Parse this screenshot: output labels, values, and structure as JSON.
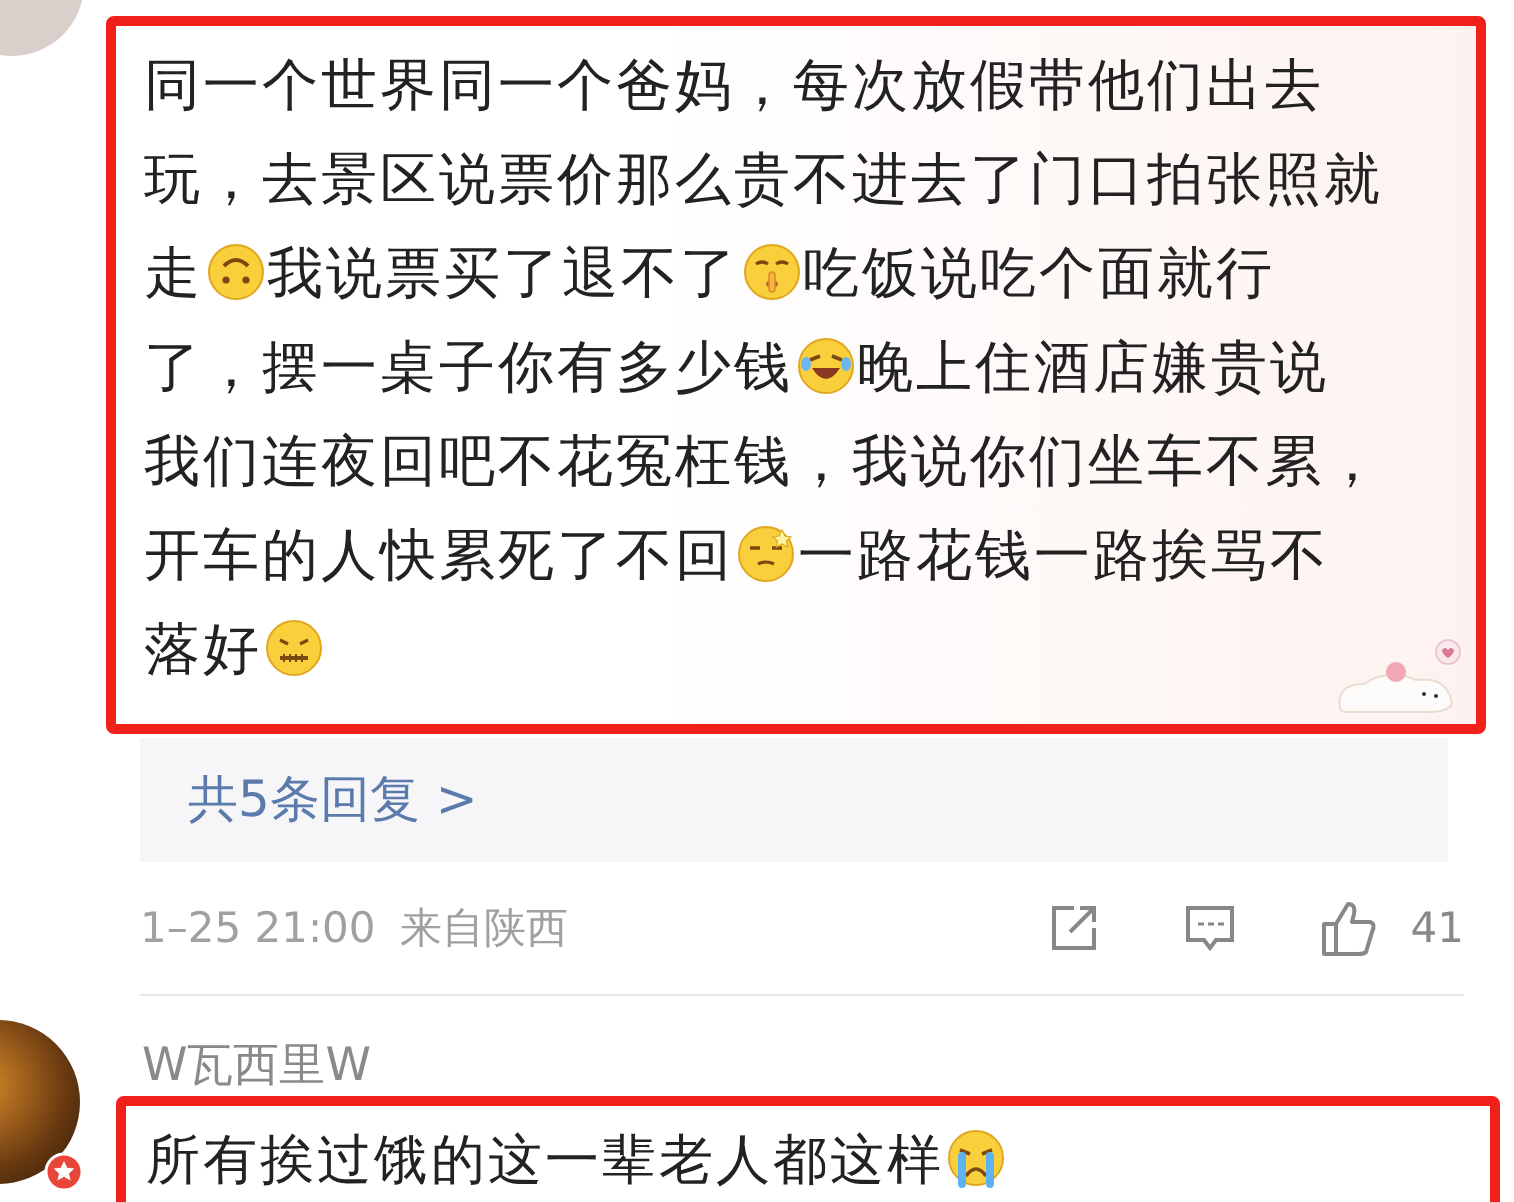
{
  "comments": [
    {
      "highlighted": true,
      "segments": [
        {
          "kind": "text",
          "text": "同一个世界同一个爸妈，每次放假带他们出去"
        },
        {
          "kind": "text",
          "text": "玩，去景区说票价那么贵不进去了门口拍张照就"
        },
        {
          "kind": "text",
          "text": "走"
        },
        {
          "kind": "face-upside-down"
        },
        {
          "kind": "text",
          "text": "我说票买了退不了"
        },
        {
          "kind": "face-shush"
        },
        {
          "kind": "text",
          "text": "吃饭说吃个面就行"
        },
        {
          "kind": "text",
          "text": "了，摆一桌子你有多少钱"
        },
        {
          "kind": "face-laugh"
        },
        {
          "kind": "text",
          "text": "晚上住酒店嫌贵说"
        },
        {
          "kind": "text",
          "text": "我们连夜回吧不花冤枉钱，我说你们坐车不累，"
        },
        {
          "kind": "text",
          "text": "开车的人快累死了不回"
        },
        {
          "kind": "face-dizzy"
        },
        {
          "kind": "text",
          "text": "一路花钱一路挨骂不"
        },
        {
          "kind": "text",
          "text": "落好"
        },
        {
          "kind": "face-sealed"
        }
      ],
      "replies_link": "共5条回复 >",
      "time": "1–25 21:00",
      "source": "来自陕西",
      "likes": "41"
    },
    {
      "username": "W瓦西里W",
      "badge": true,
      "highlighted": true,
      "segments": [
        {
          "kind": "text",
          "text": "所有挨过饿的这一辈老人都这样"
        },
        {
          "kind": "face-cry"
        }
      ]
    }
  ]
}
